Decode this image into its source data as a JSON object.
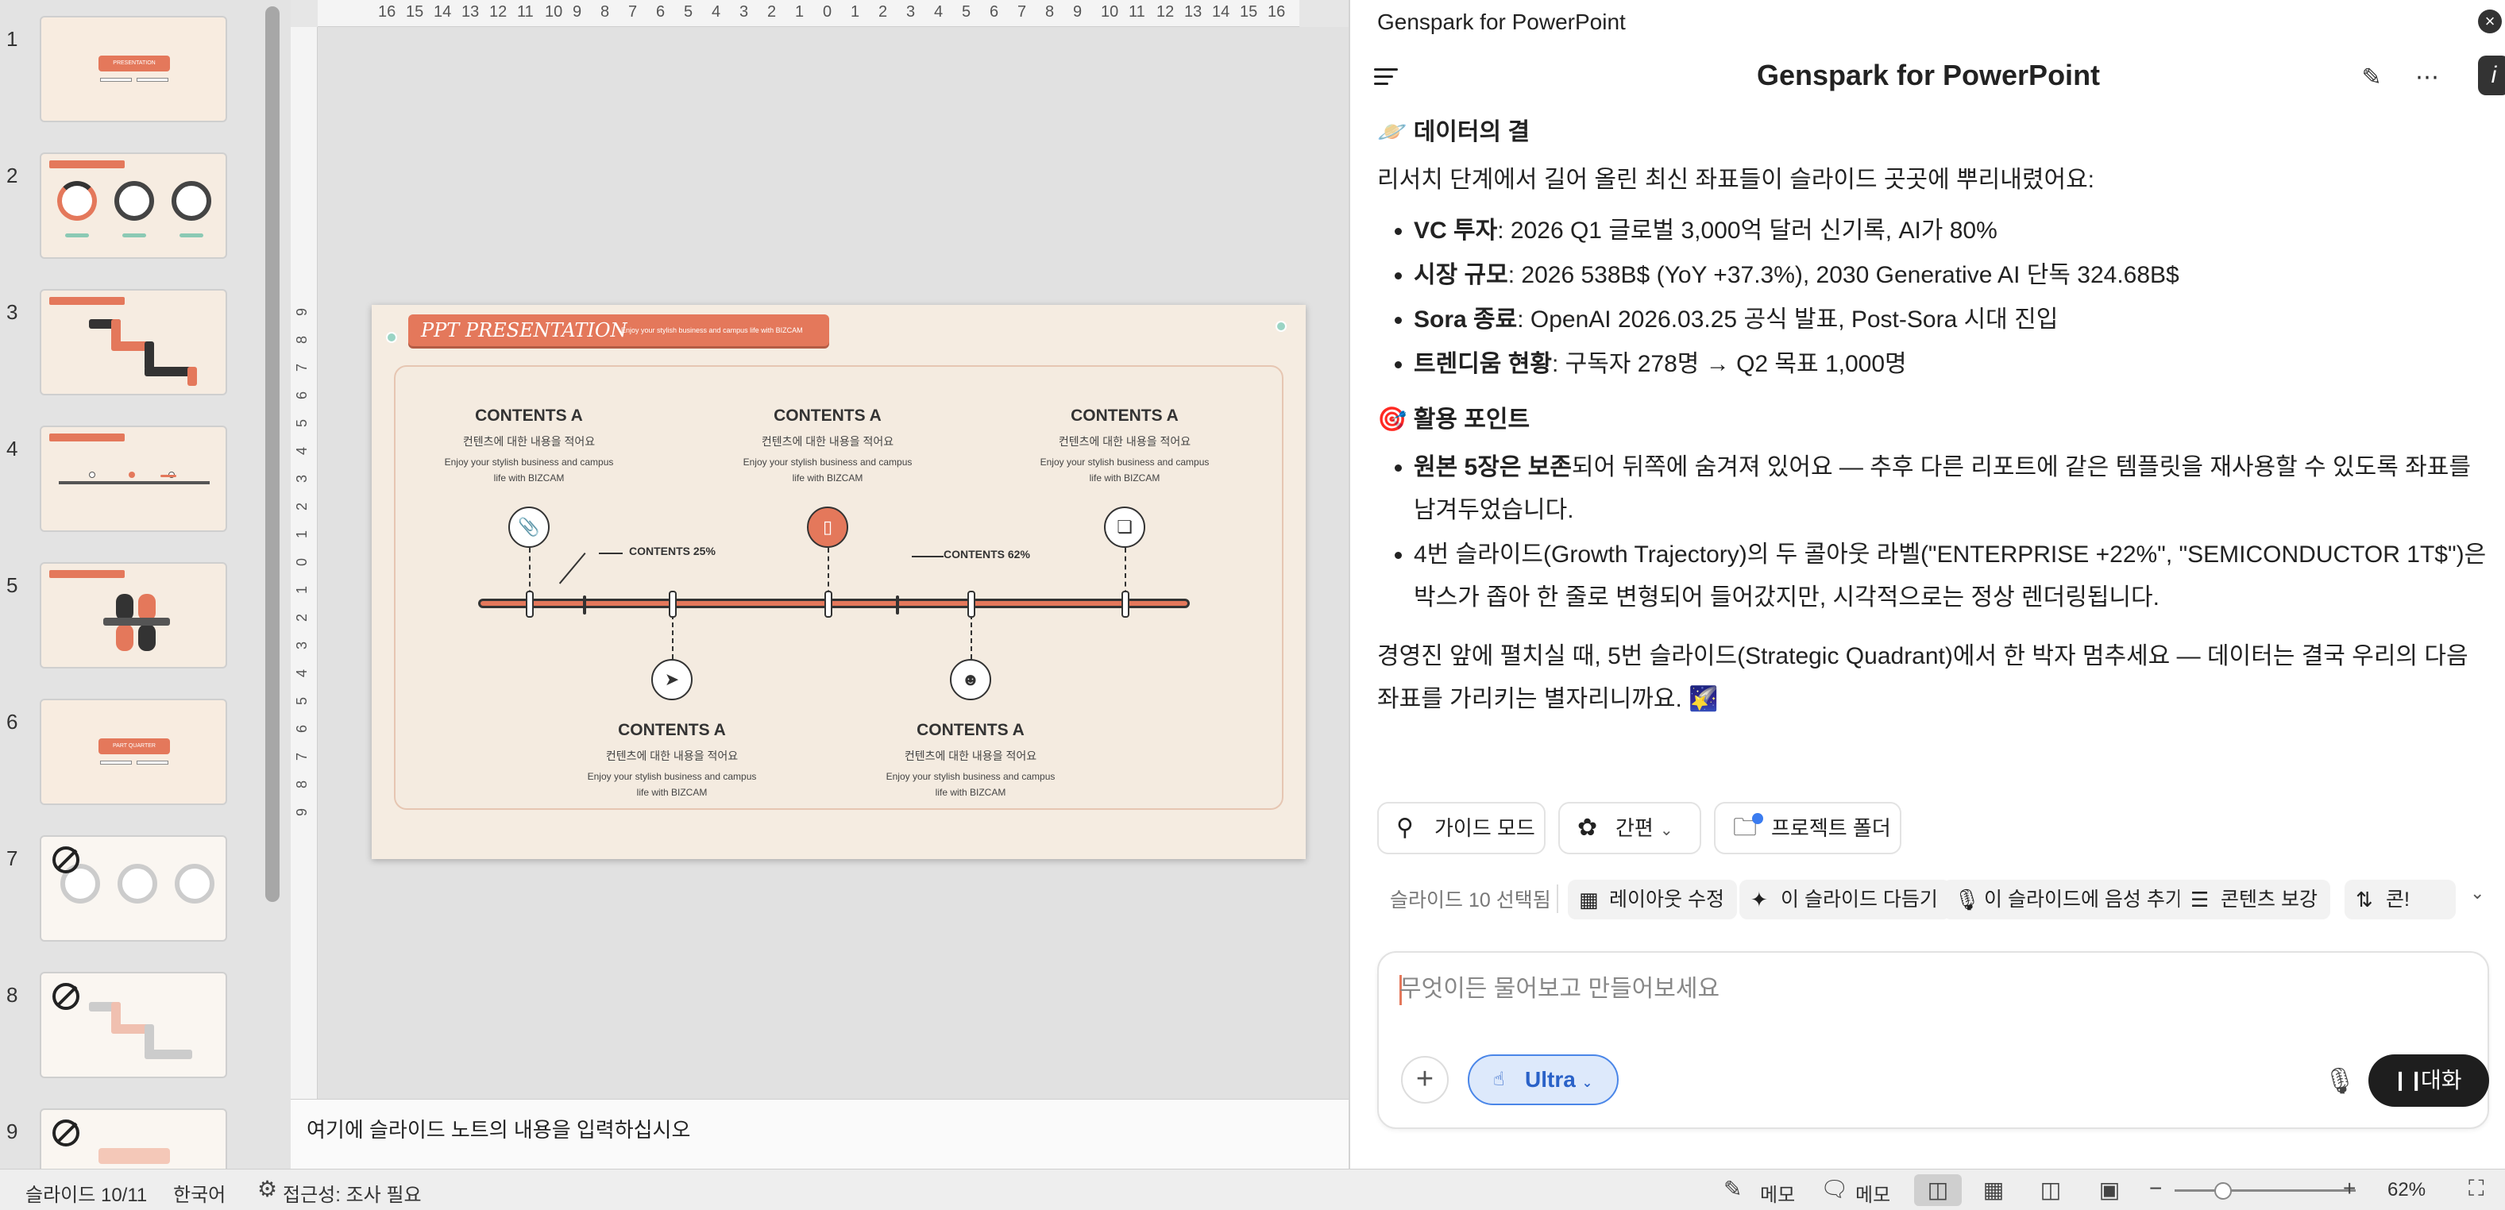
{
  "thumbnails": [
    {
      "num": "1",
      "label": "PRESENTATION"
    },
    {
      "num": "2"
    },
    {
      "num": "3"
    },
    {
      "num": "4"
    },
    {
      "num": "5"
    },
    {
      "num": "6",
      "label": "PART QUARTER"
    },
    {
      "num": "7"
    },
    {
      "num": "8"
    },
    {
      "num": "9"
    }
  ],
  "ruler": {
    "top_ticks": [
      "16",
      "15",
      "14",
      "13",
      "12",
      "11",
      "10",
      "9",
      "8",
      "7",
      "6",
      "5",
      "4",
      "3",
      "2",
      "1",
      "0",
      "1",
      "2",
      "3",
      "4",
      "5",
      "6",
      "7",
      "8",
      "9",
      "10",
      "11",
      "12",
      "13",
      "14",
      "15",
      "16"
    ],
    "left_ticks": [
      "9",
      "8",
      "7",
      "6",
      "5",
      "4",
      "3",
      "2",
      "1",
      "0",
      "1",
      "2",
      "3",
      "4",
      "5",
      "6",
      "7",
      "8",
      "9"
    ]
  },
  "slide": {
    "title": "PPT PRESENTATION",
    "subtitle": "Enjoy your stylish business and campus life with BIZCAM",
    "blocks": [
      {
        "title": "CONTENTS A",
        "kr": "컨텐츠에 대한 내용을 적어요",
        "en": "Enjoy your stylish business and campus life with BIZCAM"
      },
      {
        "title": "CONTENTS A",
        "kr": "컨텐츠에 대한 내용을 적어요",
        "en": "Enjoy your stylish business and campus life with BIZCAM"
      },
      {
        "title": "CONTENTS A",
        "kr": "컨텐츠에 대한 내용을 적어요",
        "en": "Enjoy your stylish business and campus life with BIZCAM"
      },
      {
        "title": "CONTENTS A",
        "kr": "컨텐츠에 대한 내용을 적어요",
        "en": "Enjoy your stylish business and campus life with BIZCAM"
      },
      {
        "title": "CONTENTS A",
        "kr": "컨텐츠에 대한 내용을 적어요",
        "en": "Enjoy your stylish business and campus life with BIZCAM"
      }
    ],
    "pct_left": "CONTENTS 25%",
    "pct_right": "CONTENTS 62%",
    "accent": "#e4785b"
  },
  "notes": {
    "placeholder": "여기에 슬라이드 노트의 내용을 입력하십시오"
  },
  "panel": {
    "titlebar": "Genspark for PowerPoint",
    "brand": "Genspark for PowerPoint",
    "badge": "i",
    "section1": {
      "icon": "🪐",
      "title": "데이터의 결",
      "intro": "리서치 단계에서 길어 올린 최신 좌표들이 슬라이드 곳곳에 뿌리내렸어요:",
      "items": [
        {
          "bold": "VC 투자",
          "text": ": 2026 Q1 글로벌 3,000억 달러 신기록, AI가 80%"
        },
        {
          "bold": "시장 규모",
          "text": ": 2026 538B$ (YoY +37.3%), 2030 Generative AI 단독 324.68B$"
        },
        {
          "bold": "Sora 종료",
          "text": ": OpenAI 2026.03.25 공식 발표, Post-Sora 시대 진입"
        },
        {
          "bold": "트렌디움 현황",
          "text": ": 구독자 278명 → Q2 목표 1,000명"
        }
      ]
    },
    "section2": {
      "icon": "🎯",
      "title": "활용 포인트",
      "items": [
        {
          "bold": "원본 5장은 보존",
          "text": "되어 뒤쪽에 숨겨져 있어요 — 추후 다른 리포트에 같은 템플릿을 재사용할 수 있도록 좌표를 남겨두었습니다."
        },
        {
          "bold": "",
          "text": "4번 슬라이드(Growth Trajectory)의 두 콜아웃 라벨(\"ENTERPRISE +22%\", \"SEMICONDUCTOR 1T$\")은 박스가 좁아 한 줄로 변형되어 들어갔지만, 시각적으로는 정상 렌더링됩니다."
        }
      ]
    },
    "closing": "경영진 앞에 펼치실 때, 5번 슬라이드(Strategic Quadrant)에서 한 박자 멈추세요 — 데이터는 결국 우리의 다음 좌표를 가리키는 별자리니까요. 🌠",
    "actions": {
      "guide": "가이드 모드",
      "simple": "간편",
      "project": "프로젝트 폴더"
    },
    "quick": {
      "selected": "슬라이드 10 선택됨",
      "layout": "레이아웃 수정",
      "polish": "이 슬라이드 다듬기",
      "voice": "이 슬라이드에 음성 추가",
      "content": "콘텐츠 보강",
      "more": "콘!"
    },
    "input": {
      "placeholder": "무엇이든 물어보고 만들어보세요",
      "value": "",
      "ultra": "Ultra",
      "talk": "대화"
    }
  },
  "status": {
    "slide": "슬라이드 10/11",
    "lang": "한국어",
    "access": "접근성: 조사 필요",
    "memo1": "메모",
    "memo2": "메모",
    "zoom": "62%"
  }
}
